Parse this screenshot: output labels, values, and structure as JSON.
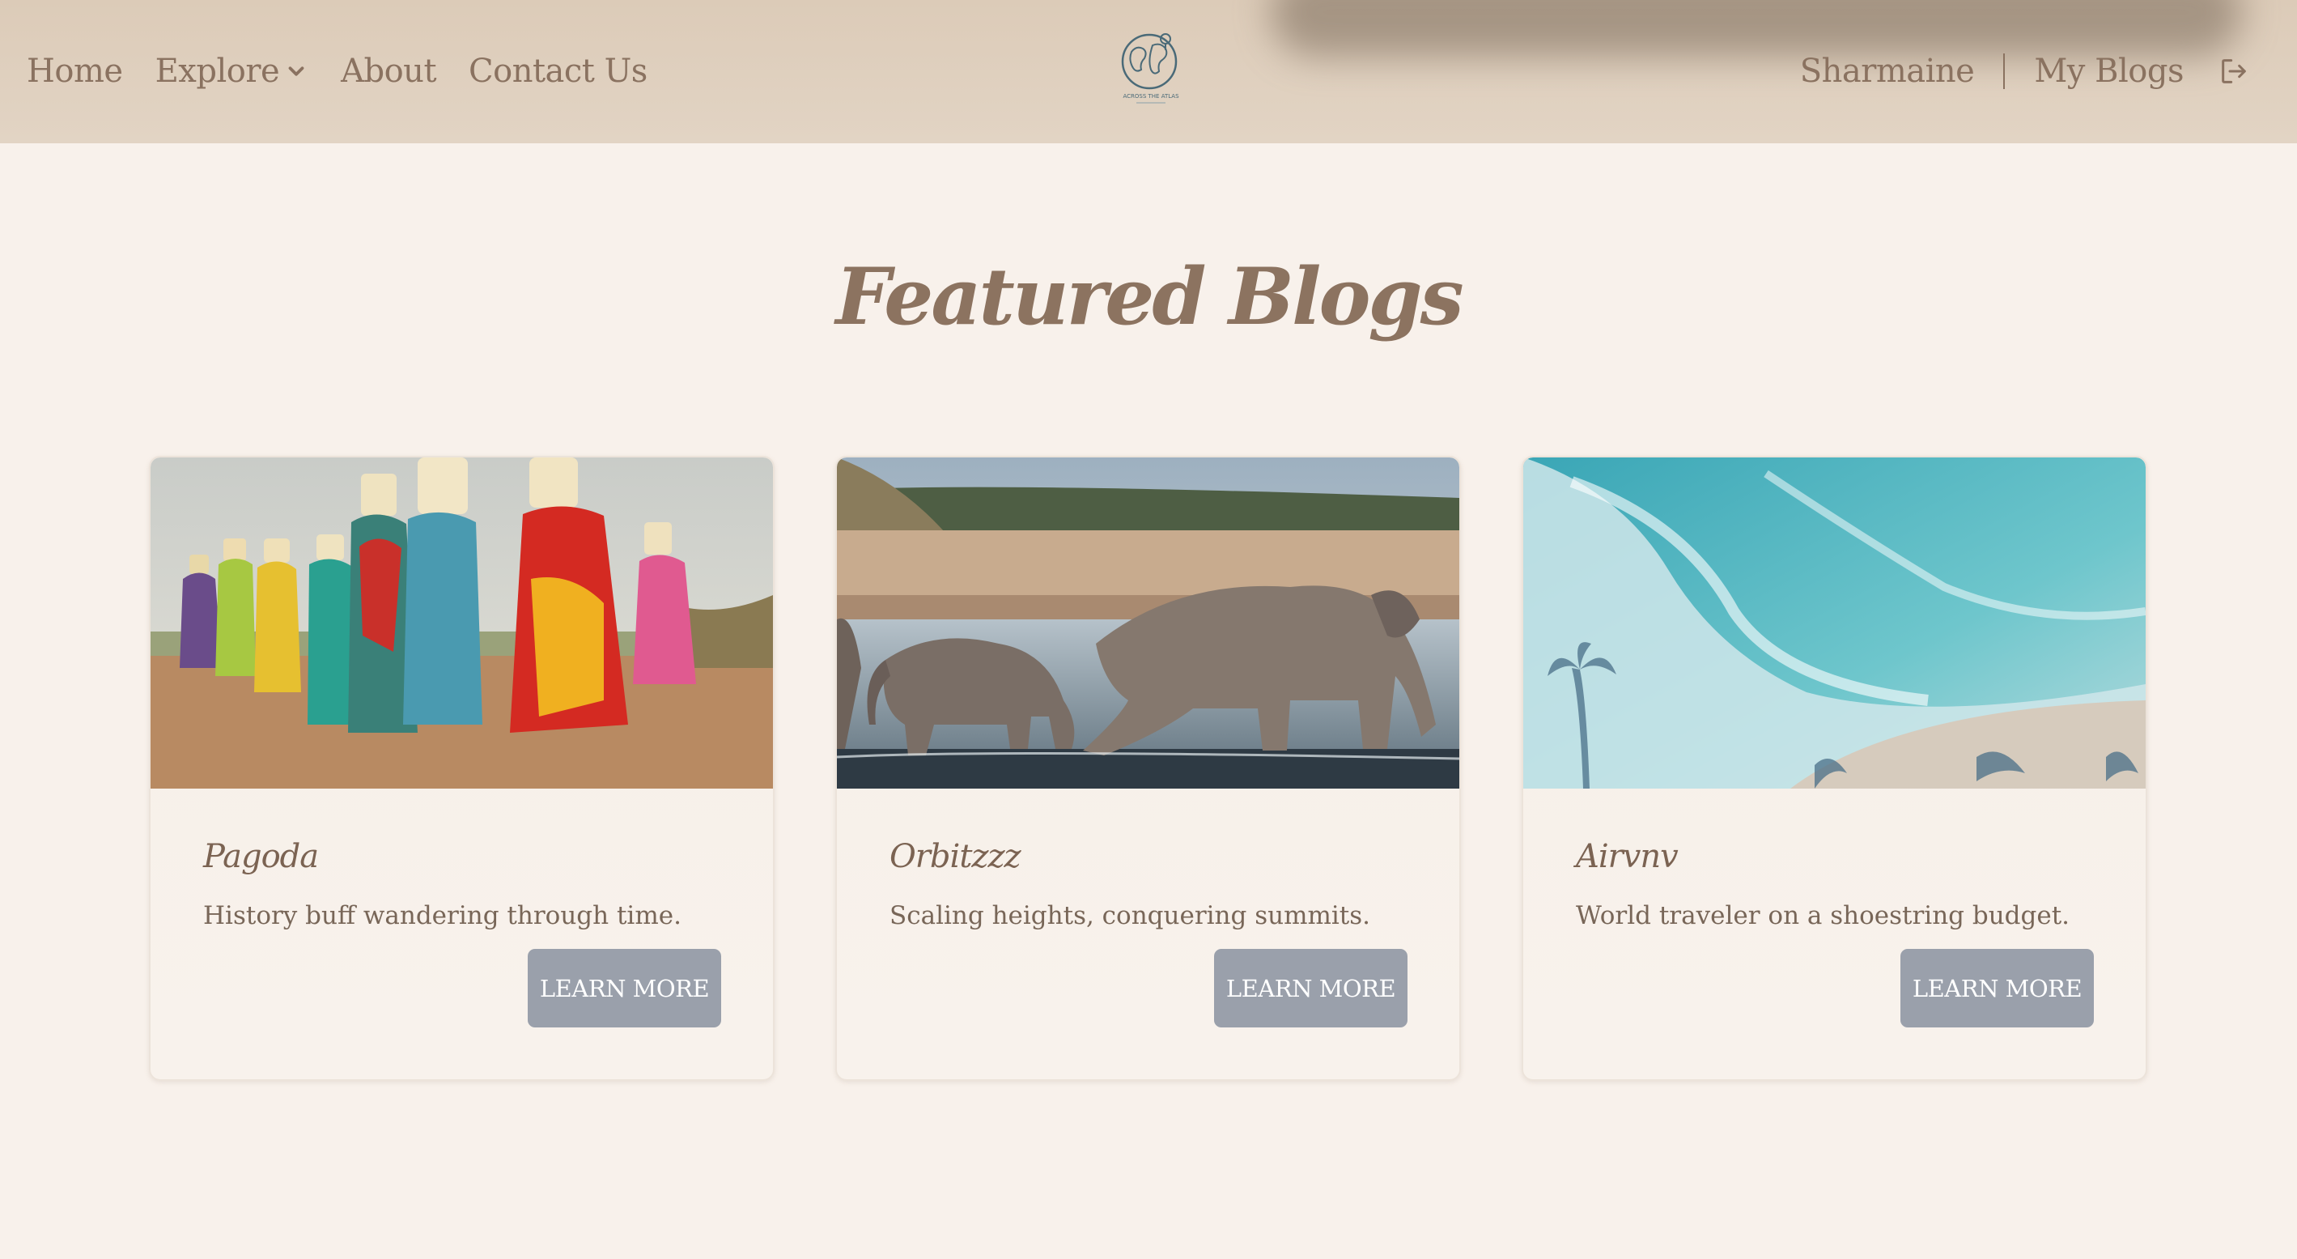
{
  "nav": {
    "home": "Home",
    "explore": "Explore",
    "about": "About",
    "contact": "Contact Us",
    "user": "Sharmaine",
    "my_blogs": "My Blogs"
  },
  "logo": {
    "text": "ACROSS THE ATLAS"
  },
  "main": {
    "title": "Featured Blogs"
  },
  "cards": [
    {
      "name": "Pagoda",
      "description": "History buff wandering through time.",
      "button": "LEARN MORE",
      "image": "women-carrying-water-jugs"
    },
    {
      "name": "Orbitzzz",
      "description": "Scaling heights, conquering summits.",
      "button": "LEARN MORE",
      "image": "elephants-crossing-river"
    },
    {
      "name": "Airvnv",
      "description": "World traveler on a shoestring budget.",
      "button": "LEARN MORE",
      "image": "aerial-ocean-beach"
    }
  ],
  "colors": {
    "header_bg": "#dccbb8",
    "page_bg": "#f8f1eb",
    "text_brown": "#8a7260",
    "button_gray": "#9aa0ab"
  }
}
